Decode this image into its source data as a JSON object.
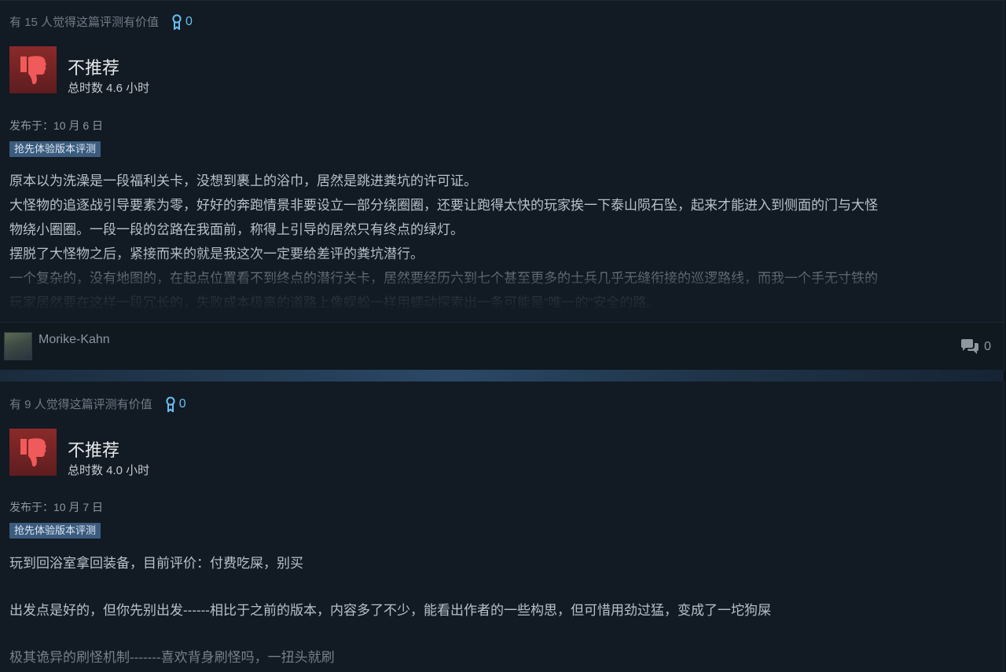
{
  "reviews": [
    {
      "helpful_text": "有 15 人觉得这篇评测有价值",
      "award_count": "0",
      "verdict": "不推荐",
      "hours": "总时数 4.6 小时",
      "posted": "发布于：10 月 6 日",
      "early_access_tag": "抢先体验版本评测",
      "body_lines": [
        "原本以为洗澡是一段福利关卡，没想到裹上的浴巾，居然是跳进粪坑的许可证。",
        "大怪物的追逐战引导要素为零，好好的奔跑情景非要设立一部分绕圈圈，还要让跑得太快的玩家挨一下泰山陨石坠，起来才能进入到侧面的门与大怪",
        "物绕小圈圈。一段一段的岔路在我面前，称得上引导的居然只有终点的绿灯。",
        "摆脱了大怪物之后，紧接而来的就是我这次一定要给差评的粪坑潜行。",
        "一个复杂的，没有地图的，在起点位置看不到终点的潜行关卡，居然要经历六到七个甚至更多的士兵几乎无缝衔接的巡逻路线，而我一个手无寸铁的",
        "玩家居然要在这样一段冗长的，失败成本极高的道路上像蜈蚣一样用蠕动探索出一条可能是“唯一的”安全的路。"
      ],
      "author": "Morike-Kahn",
      "comment_count": "0"
    },
    {
      "helpful_text": "有 9 人觉得这篇评测有价值",
      "award_count": "0",
      "verdict": "不推荐",
      "hours": "总时数 4.0 小时",
      "posted": "发布于：10 月 7 日",
      "early_access_tag": "抢先体验版本评测",
      "body_lines": [
        "玩到回浴室拿回装备，目前评价：付费吃屎，别买",
        "",
        "出发点是好的，但你先别出发------相比于之前的版本，内容多了不少，能看出作者的一些构思，但可惜用劲过猛，变成了一坨狗屎",
        "",
        "极其诡异的刷怪机制-------喜欢背身刷怪吗，一扭头就刷"
      ]
    }
  ],
  "colors": {
    "page_bg": "#121a23",
    "accent": "#66c0f4",
    "thumb_down": "#8a2a2a",
    "tag_bg": "#3b5c7e"
  },
  "icons": {
    "award": "award-ribbon-icon",
    "thumb": "thumbs-down-icon",
    "comments": "comment-bubbles-icon"
  }
}
